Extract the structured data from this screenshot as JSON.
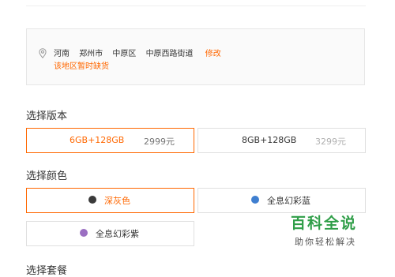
{
  "address": {
    "parts": [
      "河南",
      "郑州市",
      "中原区",
      "中原西路街道"
    ],
    "edit_label": "修改",
    "stock_notice": "该地区暂时缺货",
    "icon": "location-pin-icon"
  },
  "version_section": {
    "title": "选择版本",
    "options": [
      {
        "name": "6GB+128GB",
        "price": "2999元",
        "state": "selected"
      },
      {
        "name": "8GB+128GB",
        "price": "3299元",
        "state": "disabled"
      }
    ]
  },
  "color_section": {
    "title": "选择颜色",
    "options": [
      {
        "name": "深灰色",
        "swatch": "#3a3a3a",
        "state": "selected"
      },
      {
        "name": "全息幻彩蓝",
        "swatch": "#3f7fd0",
        "state": "normal"
      },
      {
        "name": "全息幻彩紫",
        "swatch": "#9b6fc2",
        "state": "normal"
      }
    ]
  },
  "package_section": {
    "title": "选择套餐"
  },
  "watermark": {
    "title": "百科全说",
    "subtitle": "助你轻松解决"
  },
  "colors": {
    "accent": "#ff6700",
    "border": "#e0e0e0",
    "watermark_green": "#2f9e48"
  }
}
